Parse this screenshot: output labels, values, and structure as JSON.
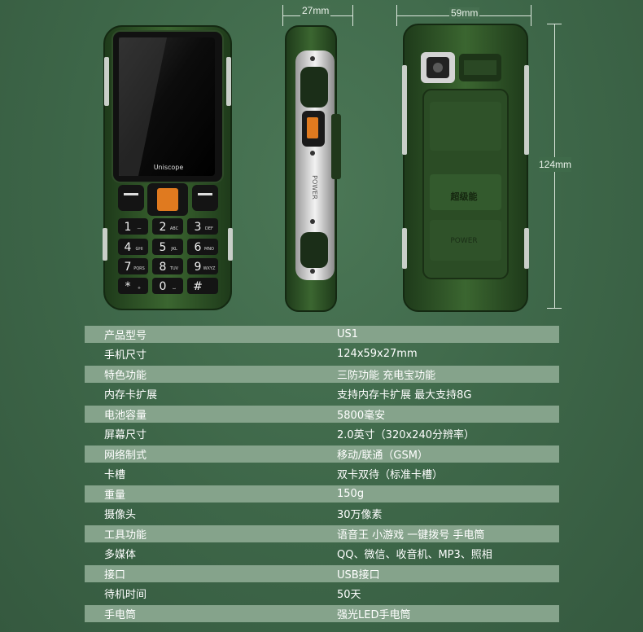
{
  "dimensions": {
    "thickness": "27mm",
    "width": "59mm",
    "height": "124mm"
  },
  "phone": {
    "brand": "Uniscope",
    "side_label": "POWER",
    "back_label": "超级能",
    "back_power_label": "POWER",
    "keys": [
      {
        "num": "1",
        "sub": "—"
      },
      {
        "num": "2",
        "sub": "ABC"
      },
      {
        "num": "3",
        "sub": "DEF"
      },
      {
        "num": "4",
        "sub": "GHI"
      },
      {
        "num": "5",
        "sub": "JKL"
      },
      {
        "num": "6",
        "sub": "MNO"
      },
      {
        "num": "7",
        "sub": "PQRS"
      },
      {
        "num": "8",
        "sub": "TUV"
      },
      {
        "num": "9",
        "sub": "WXYZ"
      },
      {
        "num": "*",
        "sub": "+"
      },
      {
        "num": "0",
        "sub": "⌴"
      },
      {
        "num": "#",
        "sub": ""
      }
    ]
  },
  "specs": [
    {
      "key": "产品型号",
      "value": "US1"
    },
    {
      "key": "手机尺寸",
      "value": "124x59x27mm"
    },
    {
      "key": "特色功能",
      "value": "三防功能  充电宝功能"
    },
    {
      "key": "内存卡扩展",
      "value": "支持内存卡扩展  最大支持8G"
    },
    {
      "key": "电池容量",
      "value": "5800毫安"
    },
    {
      "key": "屏幕尺寸",
      "value": "2.0英寸（320x240分辨率）"
    },
    {
      "key": "网络制式",
      "value": "移动/联通（GSM）"
    },
    {
      "key": "卡槽",
      "value": "双卡双待（标准卡槽）"
    },
    {
      "key": "重量",
      "value": "150g"
    },
    {
      "key": "摄像头",
      "value": "30万像素"
    },
    {
      "key": "工具功能",
      "value": "语音王  小游戏  一键拨号  手电筒"
    },
    {
      "key": "多媒体",
      "value": "QQ、微信、收音机、MP3、照相"
    },
    {
      "key": "接口",
      "value": "USB接口"
    },
    {
      "key": "待机时间",
      "value": "50天"
    },
    {
      "key": "手电筒",
      "value": "强光LED手电筒"
    }
  ]
}
